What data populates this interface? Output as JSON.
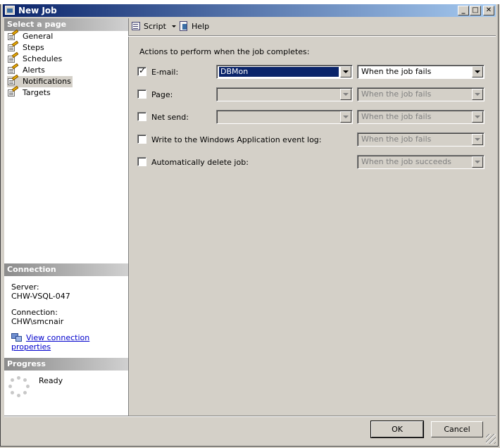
{
  "window": {
    "title": "New Job",
    "buttons": {
      "minimize": "_",
      "maximize": "□",
      "close": "✕"
    }
  },
  "sidebar": {
    "select_page_header": "Select a page",
    "items": [
      {
        "label": "General"
      },
      {
        "label": "Steps"
      },
      {
        "label": "Schedules"
      },
      {
        "label": "Alerts"
      },
      {
        "label": "Notifications",
        "selected": true
      },
      {
        "label": "Targets"
      }
    ],
    "connection": {
      "header": "Connection",
      "server_label": "Server:",
      "server_value": "CHW-VSQL-047",
      "connection_label": "Connection:",
      "connection_value": "CHW\\smcnair",
      "view_link": "View connection properties"
    },
    "progress": {
      "header": "Progress",
      "status": "Ready"
    }
  },
  "toolbar": {
    "script_label": "Script",
    "help_label": "Help"
  },
  "main": {
    "heading": "Actions to perform when the job completes:",
    "rows": [
      {
        "label": "E-mail:",
        "checked": true,
        "operator": "DBMon",
        "condition": "When the job fails"
      },
      {
        "label": "Page:",
        "checked": false,
        "operator": "",
        "condition": "When the job fails"
      },
      {
        "label": "Net send:",
        "checked": false,
        "operator": "",
        "condition": "When the job fails"
      },
      {
        "label": "Write to the Windows Application event log:",
        "checked": false,
        "condition": "When the job fails"
      },
      {
        "label": "Automatically delete job:",
        "checked": false,
        "condition": "When the job succeeds"
      }
    ]
  },
  "footer": {
    "ok_label": "OK",
    "cancel_label": "Cancel"
  },
  "colors": {
    "titlebar_start": "#0a246a",
    "titlebar_end": "#a6caf0",
    "face": "#d4d0c8",
    "link": "#0000cc",
    "selection": "#0a246a"
  }
}
